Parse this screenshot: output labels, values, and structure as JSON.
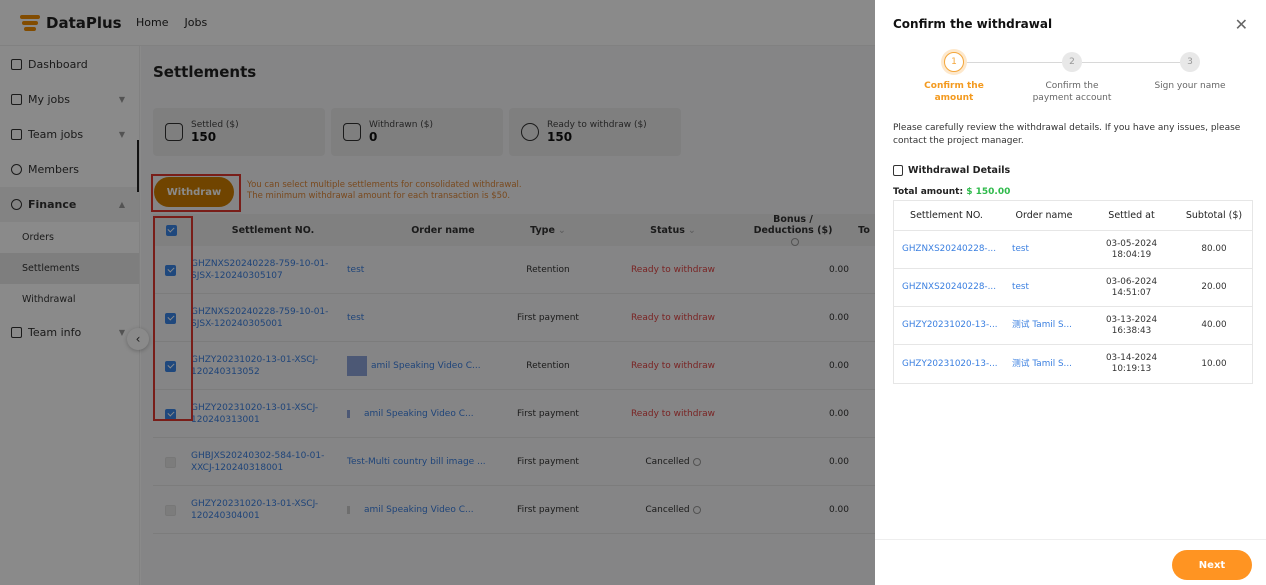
{
  "app": {
    "name": "DataPlus"
  },
  "topnav": [
    "Home",
    "Jobs"
  ],
  "sidebar": {
    "items": [
      {
        "label": "Dashboard",
        "icon": "home-icon"
      },
      {
        "label": "My jobs",
        "icon": "calendar-icon"
      },
      {
        "label": "Team jobs",
        "icon": "team-jobs-icon"
      },
      {
        "label": "Members",
        "icon": "members-icon"
      },
      {
        "label": "Finance",
        "icon": "finance-icon"
      },
      {
        "label": "Team info",
        "icon": "team-info-icon"
      }
    ],
    "finance_sub": [
      "Orders",
      "Settlements",
      "Withdrawal"
    ],
    "active_sub": "Settlements"
  },
  "main": {
    "title": "Settlements",
    "stats": [
      {
        "label": "Settled ($)",
        "value": "150",
        "icon": "database-icon"
      },
      {
        "label": "Withdrawn ($)",
        "value": "0",
        "icon": "wallet-icon"
      },
      {
        "label": "Ready to withdraw ($)",
        "value": "150",
        "icon": "dollar-coin-icon"
      }
    ],
    "withdraw_label": "Withdraw",
    "hint_line1": "You can select multiple settlements for consolidated withdrawal.",
    "hint_line2": "The minimum withdrawal amount for each transaction is $50.",
    "columns": [
      "Settlement NO.",
      "Order name",
      "Type",
      "Status",
      "Bonus / Deductions ($)",
      "To"
    ],
    "rows": [
      {
        "settlement_no": "GHZNXS20240228-759-10-01-SJSX-120240305107",
        "order_name": "test",
        "type": "Retention",
        "status": "Ready to withdraw",
        "bonus": "0.00",
        "checked": true,
        "thumb": ""
      },
      {
        "settlement_no": "GHZNXS20240228-759-10-01-SJSX-120240305001",
        "order_name": "test",
        "type": "First payment",
        "status": "Ready to withdraw",
        "bonus": "0.00",
        "checked": true,
        "thumb": ""
      },
      {
        "settlement_no": "GHZY20231020-13-01-XSCJ-120240313052",
        "order_name": "amil Speaking Video C...",
        "type": "Retention",
        "status": "Ready to withdraw",
        "bonus": "0.00",
        "checked": true,
        "thumb": "big"
      },
      {
        "settlement_no": "GHZY20231020-13-01-XSCJ-120240313001",
        "order_name": "amil Speaking Video C...",
        "type": "First payment",
        "status": "Ready to withdraw",
        "bonus": "0.00",
        "checked": true,
        "thumb": "small"
      },
      {
        "settlement_no": "GHBJXS20240302-584-10-01-XXCJ-120240318001",
        "order_name": "Test-Multi country bill image ...",
        "type": "First payment",
        "status": "Cancelled",
        "bonus": "0.00",
        "checked": false,
        "thumb": ""
      },
      {
        "settlement_no": "GHZY20231020-13-01-XSCJ-120240304001",
        "order_name": "amil Speaking Video C...",
        "type": "First payment",
        "status": "Cancelled",
        "bonus": "0.00",
        "checked": false,
        "thumb": "tiny"
      }
    ]
  },
  "drawer": {
    "title": "Confirm the withdrawal",
    "steps": [
      {
        "num": "1",
        "label_line1": "Confirm the",
        "label_line2": "amount",
        "state": "active"
      },
      {
        "num": "2",
        "label_line1": "Confirm the",
        "label_line2": "payment account",
        "state": "todo"
      },
      {
        "num": "3",
        "label_line1": "Sign your name",
        "label_line2": "",
        "state": "todo"
      }
    ],
    "description": "Please carefully review the withdrawal details. If you have any issues, please contact the project manager.",
    "details_heading": "Withdrawal Details",
    "total_label": "Total amount:",
    "total_value": "$ 150.00",
    "table_columns": [
      "Settlement NO.",
      "Order name",
      "Settled at",
      "Subtotal ($)"
    ],
    "table_rows": [
      {
        "settlement_no": "GHZNXS20240228-...",
        "order_name": "test",
        "date": "03-05-2024",
        "time": "18:04:19",
        "subtotal": "80.00"
      },
      {
        "settlement_no": "GHZNXS20240228-...",
        "order_name": "test",
        "date": "03-06-2024",
        "time": "14:51:07",
        "subtotal": "20.00"
      },
      {
        "settlement_no": "GHZY20231020-13-...",
        "order_name": "测试 Tamil S...",
        "date": "03-13-2024",
        "time": "16:38:43",
        "subtotal": "40.00"
      },
      {
        "settlement_no": "GHZY20231020-13-...",
        "order_name": "测试 Tamil S...",
        "date": "03-14-2024",
        "time": "10:19:13",
        "subtotal": "10.00"
      }
    ],
    "next_label": "Next",
    "close_glyph": "✕"
  },
  "colors": {
    "accent": "#ff9422",
    "withdraw_button": "#cf7f00",
    "link": "#3a7fe0",
    "status_ready": "#e04444",
    "total_amount": "#2fba4b",
    "highlight_box": "#e0382f"
  }
}
